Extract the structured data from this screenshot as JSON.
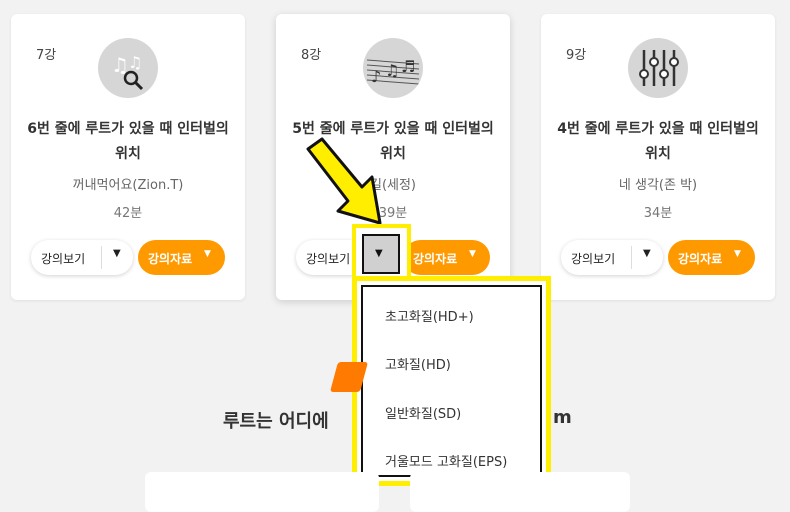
{
  "cards": [
    {
      "num": "7강",
      "title": "6번 줄에 루트가 있을 때 인터벌의 위치",
      "artist": "꺼내먹어요(Zion.T)",
      "duration": "42분",
      "icon": "music-search-icon"
    },
    {
      "num": "8강",
      "title": "5번 줄에 루트가 있을 때 인터벌의 위치",
      "artist": "길(세정)",
      "duration": "39분",
      "icon": "sheet-music-icon"
    },
    {
      "num": "9강",
      "title": "4번 줄에 루트가 있을 때 인터벌의 위치",
      "artist": "네 생각(존 박)",
      "duration": "34분",
      "icon": "equalizer-sliders-icon"
    }
  ],
  "buttons": {
    "view": "강의보기",
    "materials": "강의자료"
  },
  "dropdown": {
    "items": [
      "초고화질(HD+)",
      "고화질(HD)",
      "일반화질(SD)",
      "거울모드 고화질(EPS)"
    ]
  },
  "section": {
    "title_visible": "루트는 어디에",
    "title_tail": "m"
  },
  "colors": {
    "accent": "#ff9900",
    "highlight": "#ffee00",
    "tab": "#ff7a00"
  }
}
